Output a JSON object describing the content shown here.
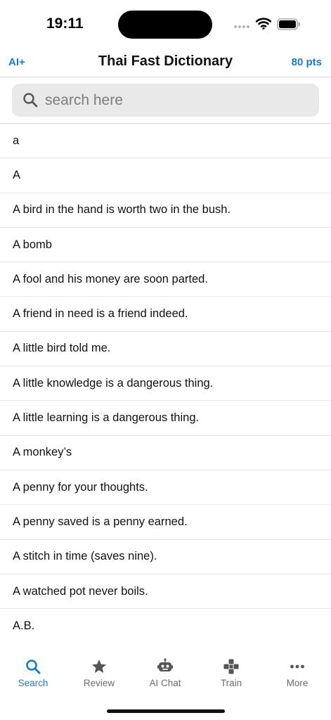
{
  "status": {
    "time": "19:11"
  },
  "nav": {
    "left_label": "AI+",
    "title": "Thai Fast Dictionary",
    "right_label": "80 pts"
  },
  "search": {
    "placeholder": "search here",
    "value": ""
  },
  "entries": [
    "a",
    "A",
    "A bird in the hand is worth two in the bush.",
    "A bomb",
    "A fool and his money are soon parted.",
    "A friend in need is a friend indeed.",
    "A little bird told me.",
    "A little knowledge is a dangerous thing.",
    "A little learning is a dangerous thing.",
    "A monkey’s",
    "A penny for your thoughts.",
    "A penny saved is a penny earned.",
    "A stitch in time (saves nine).",
    "A watched pot never boils.",
    "A.B."
  ],
  "tabs": [
    {
      "label": "Search",
      "icon": "search-icon",
      "active": true
    },
    {
      "label": "Review",
      "icon": "star-icon",
      "active": false
    },
    {
      "label": "AI Chat",
      "icon": "robot-icon",
      "active": false
    },
    {
      "label": "Train",
      "icon": "gamepad-icon",
      "active": false
    },
    {
      "label": "More",
      "icon": "ellipsis-icon",
      "active": false
    }
  ],
  "colors": {
    "accent": "#1b7cc4",
    "inactive": "#6b6b6b",
    "search_bg": "#e9e9e9"
  }
}
